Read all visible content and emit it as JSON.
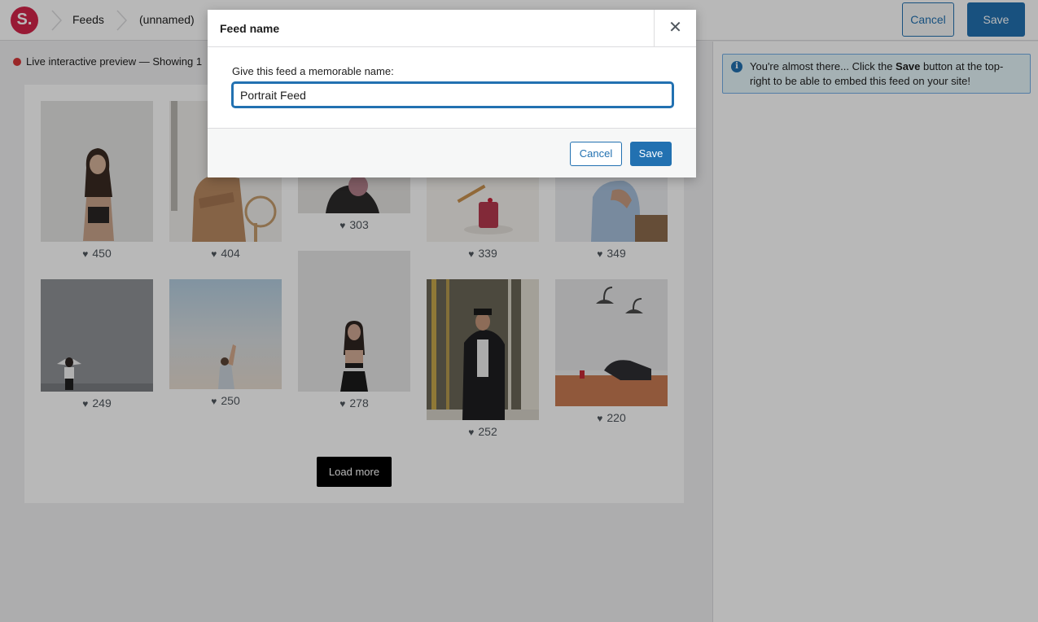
{
  "app": {
    "logo_text": "S."
  },
  "breadcrumb": {
    "items": [
      "Feeds",
      "(unnamed)"
    ]
  },
  "toolbar": {
    "cancel_label": "Cancel",
    "save_label": "Save"
  },
  "preview": {
    "status_text": "Live interactive preview — Showing 1",
    "load_more_label": "Load more",
    "posts": [
      {
        "likes": "450"
      },
      {
        "likes": "404"
      },
      {
        "likes": "303"
      },
      {
        "likes": "339"
      },
      {
        "likes": "349"
      },
      {
        "likes": "249"
      },
      {
        "likes": "250"
      },
      {
        "likes": "278"
      },
      {
        "likes": "252"
      },
      {
        "likes": "220"
      }
    ]
  },
  "sidebar": {
    "notice": {
      "icon": "info-icon",
      "text_before": "You're almost there... Click the ",
      "text_bold": "Save",
      "text_after": " button at the top-right to be able to embed this feed on your site!"
    }
  },
  "modal": {
    "title": "Feed name",
    "close_icon": "close-icon",
    "label": "Give this feed a memorable name:",
    "input_value": "Portrait Feed",
    "cancel_label": "Cancel",
    "save_label": "Save"
  },
  "colors": {
    "accent": "#2271b1",
    "brand": "#d3244a",
    "live_dot": "#d63638"
  }
}
